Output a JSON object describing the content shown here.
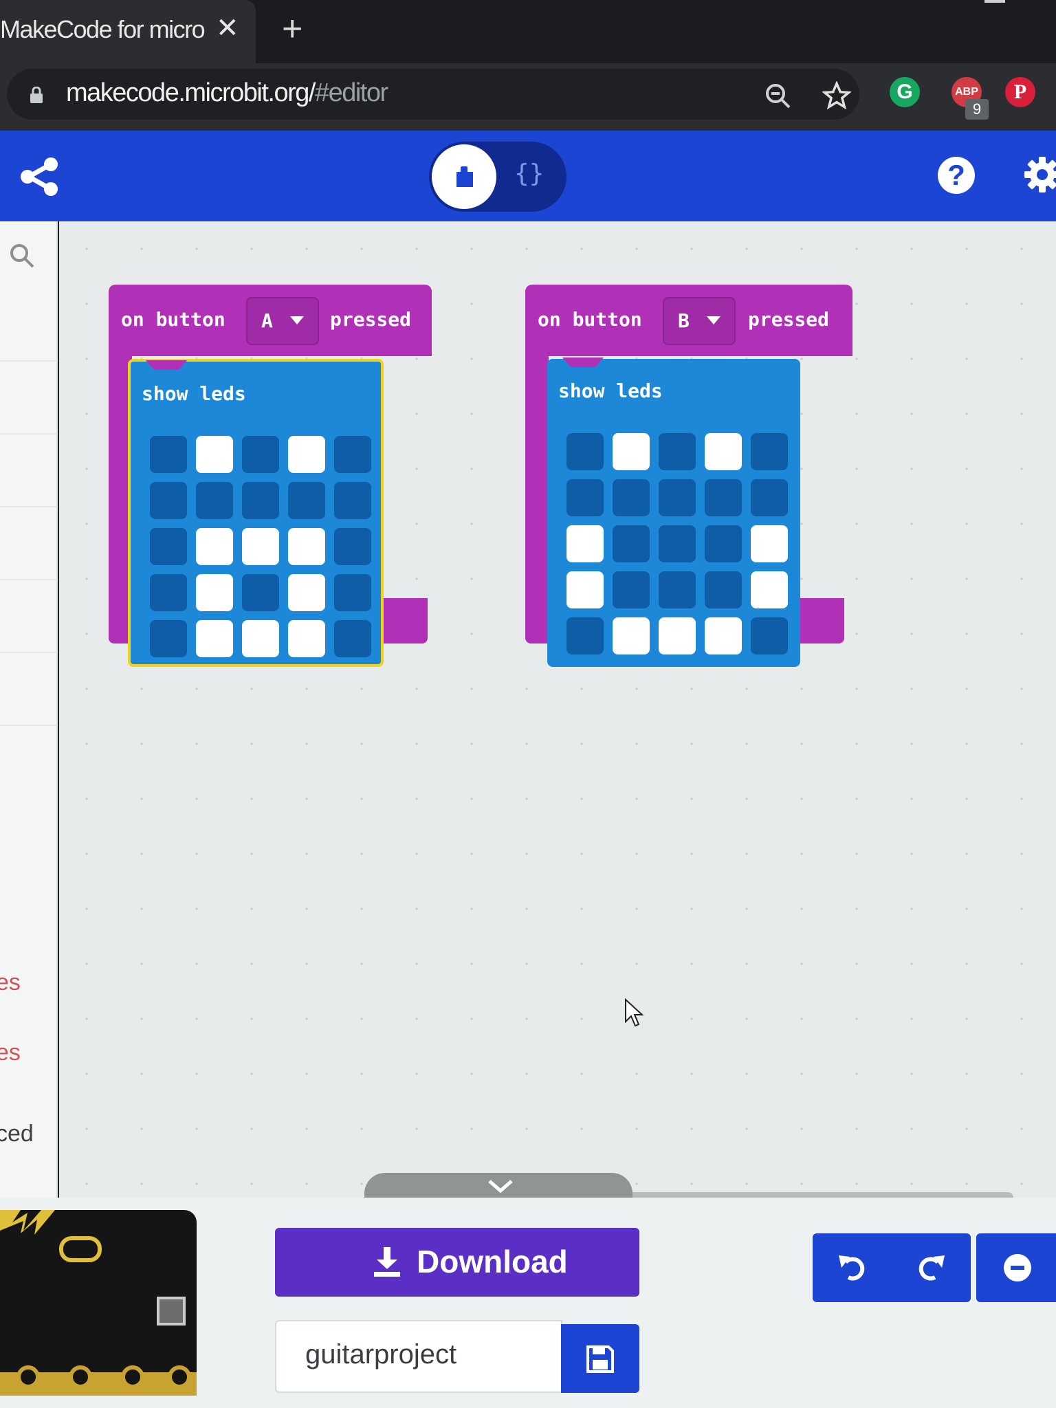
{
  "browser": {
    "tab_title": "MakeCode for micro:bit",
    "tab_close": "✕",
    "new_tab": "+",
    "url_host": "makecode.microbit.org/",
    "url_path": "#editor",
    "ext_badge": "9"
  },
  "header": {
    "js_toggle_label": "{}",
    "help_label": "?"
  },
  "sidebar": {
    "partial_labels": [
      "es",
      "ced"
    ]
  },
  "blocks": [
    {
      "prefix": "on button",
      "button": "A",
      "suffix": "pressed",
      "inner_label": "show leds",
      "selected": true,
      "leds": [
        [
          0,
          1,
          0,
          1,
          0
        ],
        [
          0,
          0,
          0,
          0,
          0
        ],
        [
          0,
          1,
          1,
          1,
          0
        ],
        [
          0,
          1,
          0,
          1,
          0
        ],
        [
          0,
          1,
          1,
          1,
          0
        ]
      ]
    },
    {
      "prefix": "on button",
      "button": "B",
      "suffix": "pressed",
      "inner_label": "show leds",
      "selected": false,
      "leds": [
        [
          0,
          1,
          0,
          1,
          0
        ],
        [
          0,
          0,
          0,
          0,
          0
        ],
        [
          1,
          0,
          0,
          0,
          1
        ],
        [
          1,
          0,
          0,
          0,
          1
        ],
        [
          0,
          1,
          1,
          1,
          0
        ]
      ]
    }
  ],
  "bottom": {
    "download_label": "Download",
    "project_name": "guitarproject"
  },
  "colors": {
    "header_blue": "#1d45d4",
    "event_purple": "#b030b8",
    "block_blue": "#1e88d8",
    "download_purple": "#5b2fc6",
    "selection_yellow": "#f2d21a"
  }
}
